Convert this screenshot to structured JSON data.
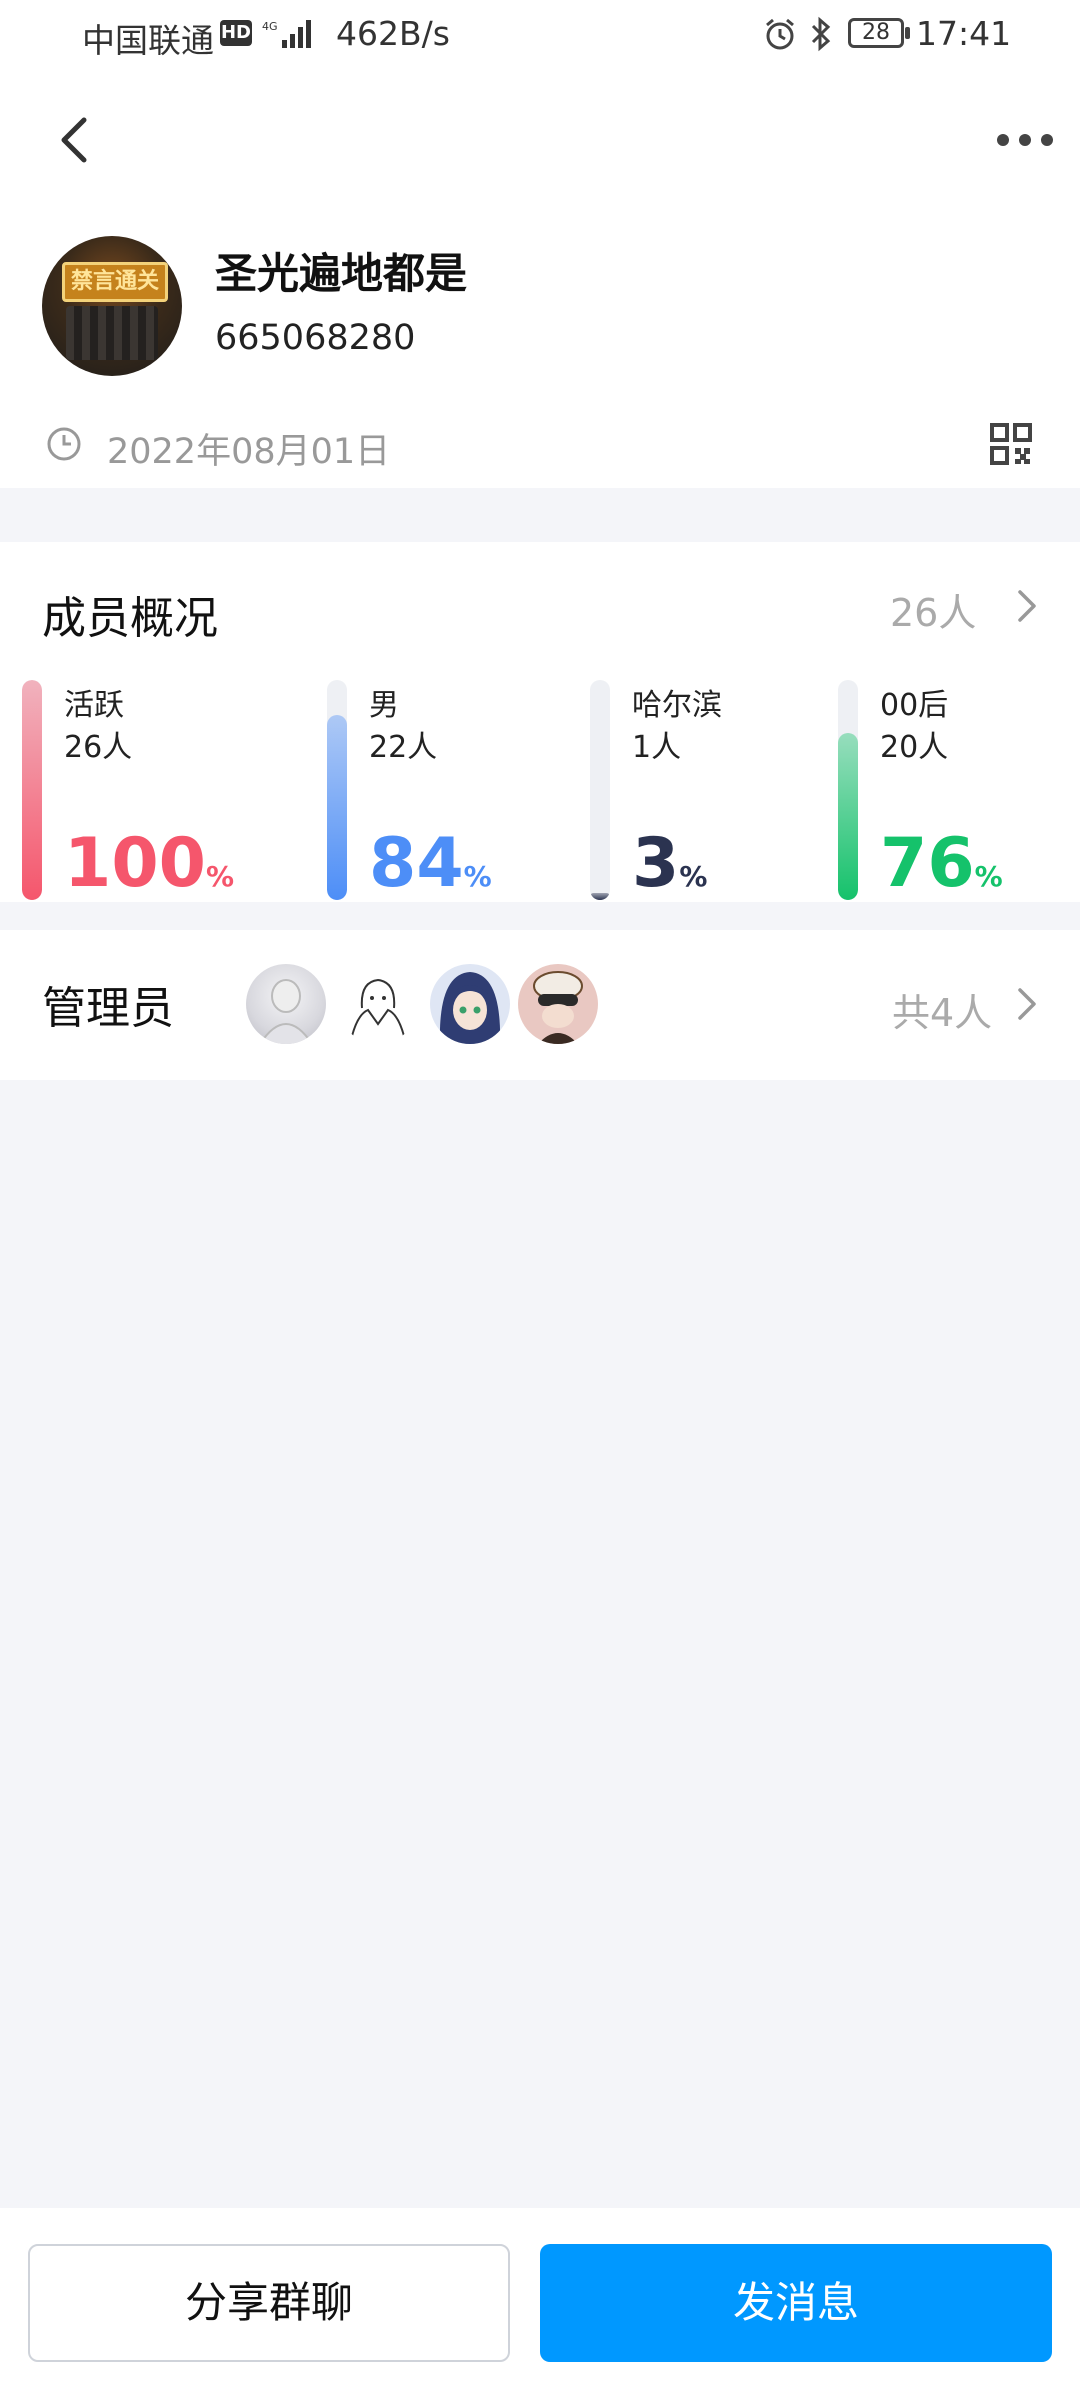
{
  "status_bar": {
    "carrier": "中国联通",
    "hd_badge": "HD",
    "network": "4G",
    "speed": "462B/s",
    "battery": "28",
    "time": "17:41"
  },
  "header": {
    "back_icon": "chevron-left-icon",
    "more_icon": "more-dots-icon"
  },
  "group": {
    "avatar_text": "禁言通关",
    "name": "圣光遍地都是",
    "id": "665068280",
    "created_date": "2022年08月01日",
    "qr_icon": "qr-code-icon"
  },
  "members": {
    "title": "成员概况",
    "total": "26人",
    "stats": [
      {
        "label": "活跃",
        "count": "26人",
        "percent": "100",
        "sign": "%",
        "fraction": 1.0,
        "color": "#f5566c"
      },
      {
        "label": "男",
        "count": "22人",
        "percent": "84",
        "sign": "%",
        "fraction": 0.84,
        "color": "#4d8ef7"
      },
      {
        "label": "哈尔滨",
        "count": "1人",
        "percent": "3",
        "sign": "%",
        "fraction": 0.03,
        "color": "#2b3350"
      },
      {
        "label": "00后",
        "count": "20人",
        "percent": "76",
        "sign": "%",
        "fraction": 0.76,
        "color": "#15c26b"
      }
    ]
  },
  "admins": {
    "title": "管理员",
    "total": "共4人"
  },
  "actions": {
    "share": "分享群聊",
    "send": "发消息"
  },
  "colors": {
    "accent": "#0098ff",
    "background": "#f4f5f9"
  }
}
